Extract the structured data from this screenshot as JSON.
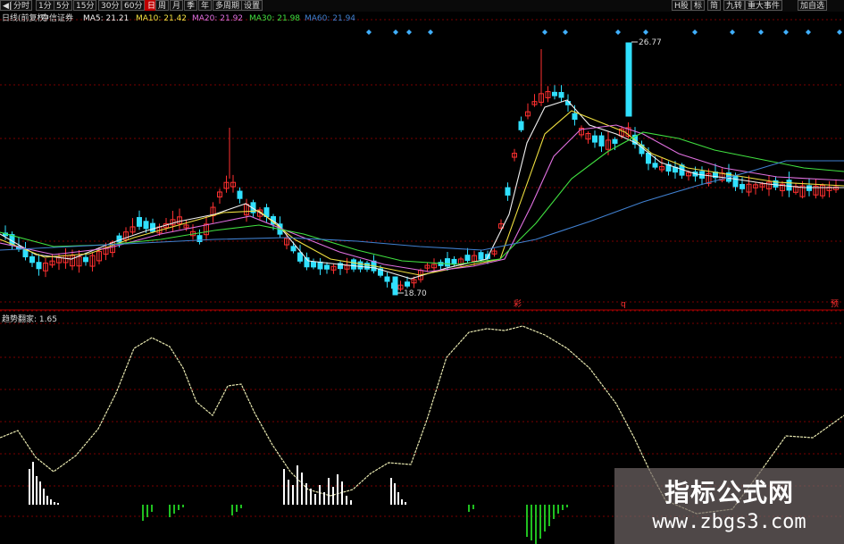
{
  "colors": {
    "up": "#ff3030",
    "down": "#30e0ff",
    "ma5": "#f0f0f0",
    "ma10": "#f0e040",
    "ma20": "#e070e0",
    "ma30": "#40e040",
    "ma60": "#4080d0",
    "grid": "#7a0000",
    "osc": "#e8e8b0",
    "hist_pos": "#ffffff",
    "hist_neg": "#20c020",
    "marker": "#40b0ff",
    "active": "#c00000"
  },
  "toolbar": {
    "left_buttons": [
      {
        "label": "◀|",
        "active": false,
        "icon": "first-icon"
      },
      {
        "label": "分时",
        "active": false
      },
      {
        "label": "1分",
        "active": false
      },
      {
        "label": "5分",
        "active": false
      },
      {
        "label": "15分",
        "active": false
      },
      {
        "label": "30分",
        "active": false
      },
      {
        "label": "60分",
        "active": false
      },
      {
        "label": "日",
        "active": true
      },
      {
        "label": "周",
        "active": false
      },
      {
        "label": "月",
        "active": false
      },
      {
        "label": "季",
        "active": false
      },
      {
        "label": "年",
        "active": false
      },
      {
        "label": "多周期",
        "active": false
      },
      {
        "label": "设置",
        "active": false
      }
    ],
    "right_buttons": [
      {
        "label": "H股"
      },
      {
        "label": "标"
      },
      {
        "label": "简"
      },
      {
        "label": "九转"
      },
      {
        "label": "重大事件"
      },
      {
        "label": "加自选"
      }
    ]
  },
  "legend": {
    "prefix": "日线(前复权)",
    "stock": "中信证券",
    "items": [
      {
        "label": "MA5: 21.21",
        "color": "#f0f0f0"
      },
      {
        "label": "MA10: 21.42",
        "color": "#f0e040"
      },
      {
        "label": "MA20: 21.92",
        "color": "#e070e0"
      },
      {
        "label": "MA30: 21.98",
        "color": "#40e040"
      },
      {
        "label": "MA60: 21.94",
        "color": "#4080d0"
      }
    ]
  },
  "price_labels": {
    "high": "26.77",
    "low": "18.70"
  },
  "signal_labels": [
    "彩",
    "q",
    "预"
  ],
  "indicator": {
    "legend": "趋势翻家: 1.65"
  },
  "watermark": {
    "title": "指标公式网",
    "url": "www.zbgs3.com"
  }
}
